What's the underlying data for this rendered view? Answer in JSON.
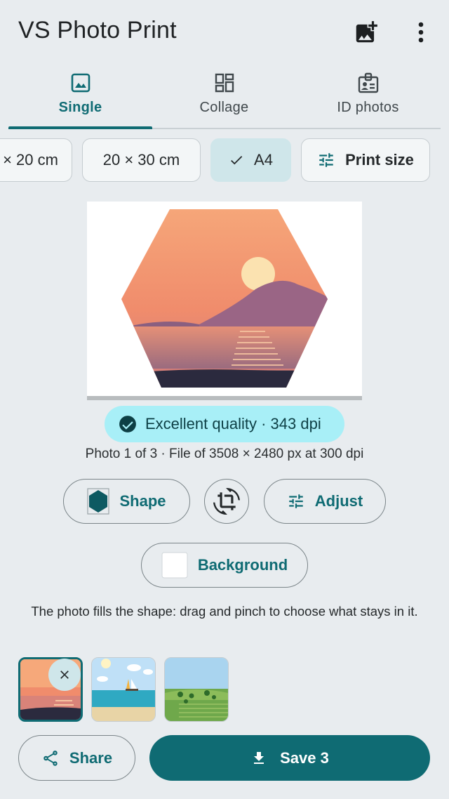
{
  "app": {
    "title": "VS Photo Print",
    "accent_color": "#0f6b73",
    "add_image_icon": "add-photo-icon",
    "menu_icon": "more-vert-icon"
  },
  "tabs": [
    {
      "label": "Single",
      "icon": "image-icon",
      "active": true
    },
    {
      "label": "Collage",
      "icon": "grid-icon",
      "active": false
    },
    {
      "label": "ID photos",
      "icon": "id-badge-icon",
      "active": false
    }
  ],
  "sizes": {
    "items": [
      {
        "label": "× 20 cm",
        "selected": false
      },
      {
        "label": "20 × 30 cm",
        "selected": false
      },
      {
        "label": "A4",
        "selected": true
      }
    ],
    "print_size_label": "Print size"
  },
  "quality": {
    "label": "Excellent quality · 343 dpi",
    "badge_color": "#a8eff7"
  },
  "photo_info": "Photo 1 of 3 · File of 3508 × 2480 px at 300 dpi",
  "tools": {
    "shape_label": "Shape",
    "adjust_label": "Adjust",
    "background_label": "Background",
    "crop_icon": "crop-rotate-icon"
  },
  "hint": "The photo fills the shape: drag and pinch to choose what stays in it.",
  "thumbnails": [
    {
      "name": "sunset",
      "selected": true
    },
    {
      "name": "beach",
      "selected": false
    },
    {
      "name": "countryside",
      "selected": false
    }
  ],
  "actions": {
    "share_label": "Share",
    "save_label": "Save 3"
  }
}
